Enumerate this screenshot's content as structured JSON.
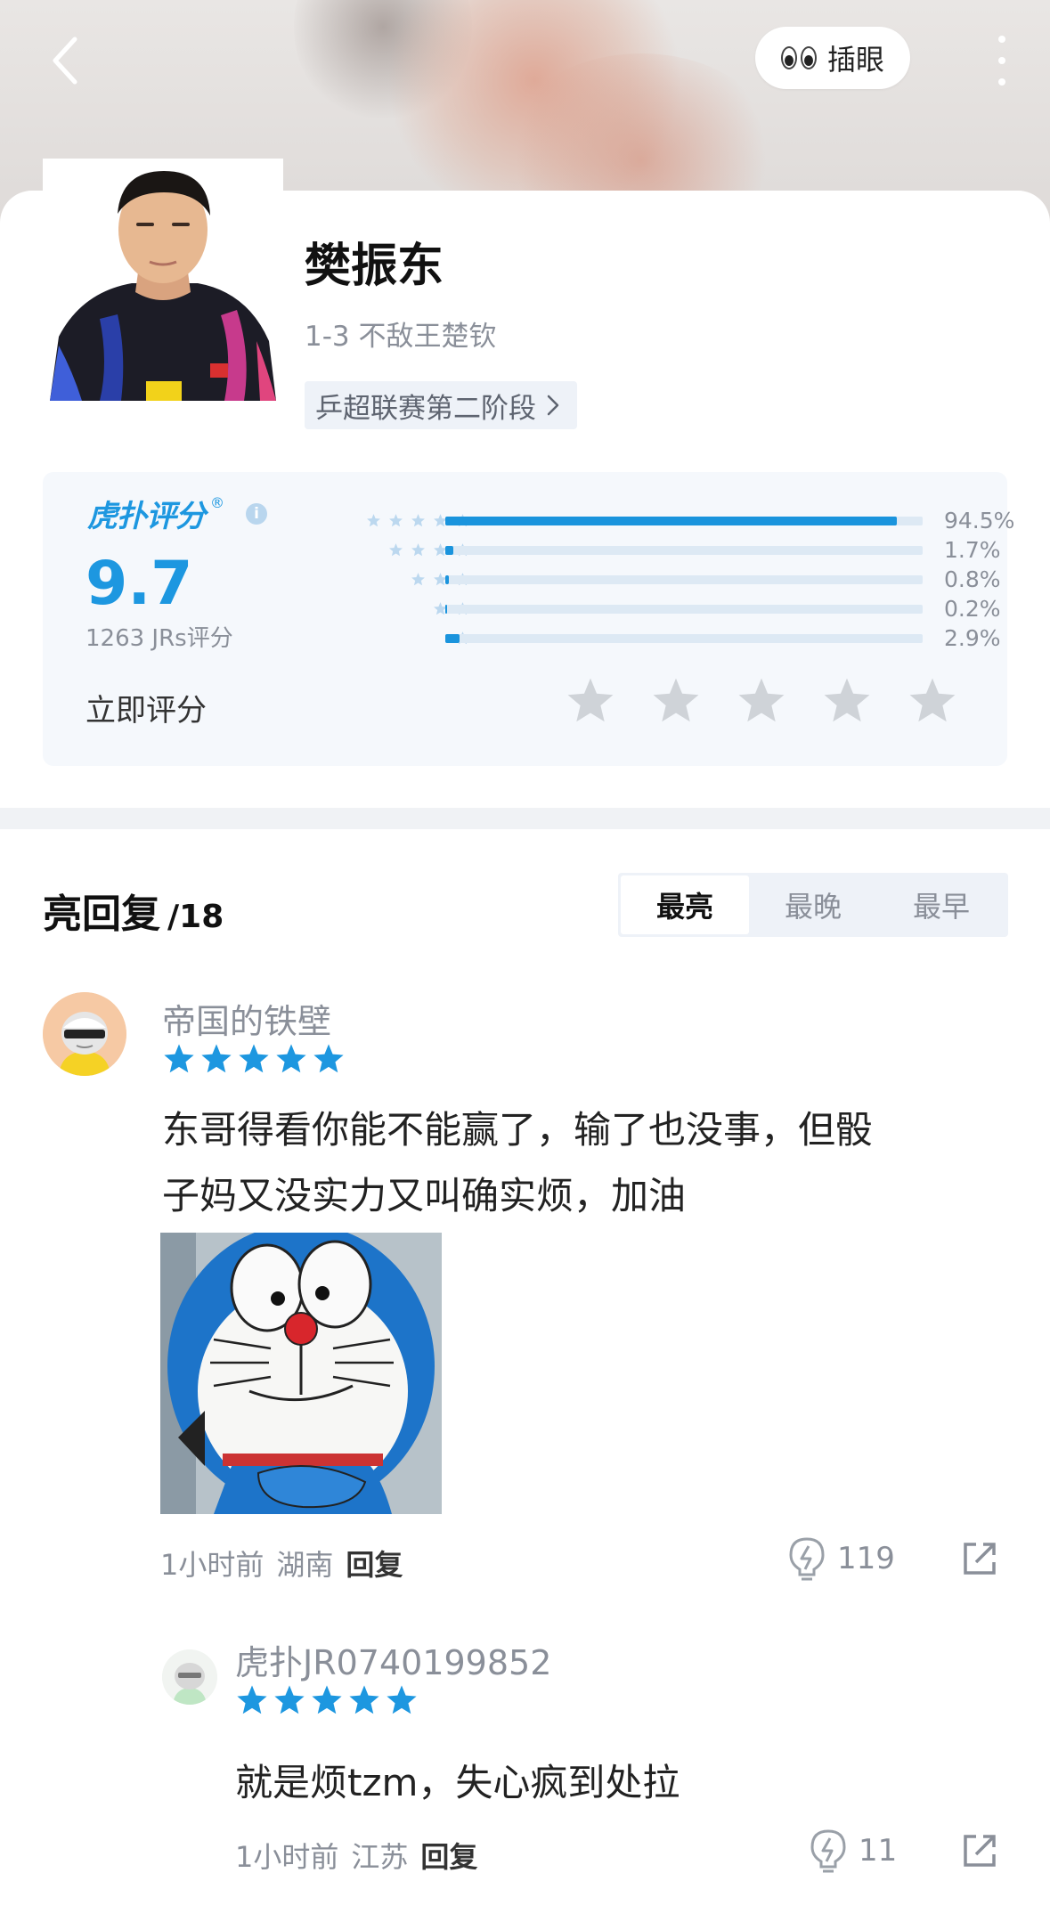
{
  "header": {
    "peek_label": "插眼"
  },
  "player": {
    "name": "樊振东",
    "subtitle": "1-3 不敌王楚钦",
    "event_tag": "乒超联赛第二阶段"
  },
  "rating": {
    "brand": "虎扑评分",
    "score": "9.7",
    "count": "1263 JRs评分",
    "rate_label": "立即评分",
    "accent_color": "#1d97e0",
    "distribution": [
      {
        "stars": 5,
        "percent": "94.5%",
        "value": 94.5
      },
      {
        "stars": 4,
        "percent": "1.7%",
        "value": 1.7
      },
      {
        "stars": 3,
        "percent": "0.8%",
        "value": 0.8
      },
      {
        "stars": 2,
        "percent": "0.2%",
        "value": 0.2
      },
      {
        "stars": 1,
        "percent": "2.9%",
        "value": 2.9
      }
    ]
  },
  "replies_section": {
    "title": "亮回复",
    "count": "/18",
    "tabs": [
      "最亮",
      "最晚",
      "最早"
    ],
    "active_tab": "最亮"
  },
  "replies": [
    {
      "username": "帝国的铁壁",
      "stars": 5,
      "text_line1": "东哥得看你能不能赢了，输了也没事，但骰",
      "text_line2": "子妈又没实力又叫确实烦，加油",
      "time": "1小时前",
      "location": "湖南",
      "reply_label": "回复",
      "likes": "119"
    },
    {
      "username": "虎扑JR0740199852",
      "stars": 5,
      "text": "就是烦tzm，失心疯到处拉",
      "time": "1小时前",
      "location": "江苏",
      "reply_label": "回复",
      "likes": "11"
    }
  ]
}
